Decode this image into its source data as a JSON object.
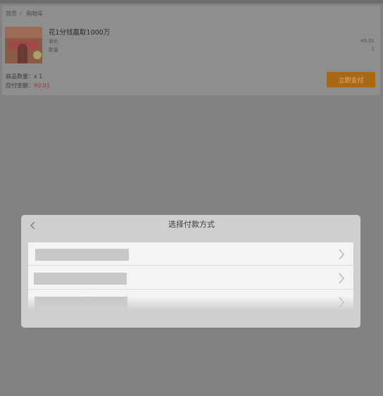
{
  "breadcrumb": {
    "items": [
      "首页",
      "购物车"
    ],
    "separator": "/"
  },
  "product": {
    "name": "花1分钱赢取1000万",
    "rows": [
      {
        "label": "单价",
        "value": "¥0.01"
      },
      {
        "label": "数量",
        "value": "1"
      }
    ]
  },
  "summary": {
    "count_label": "商品数量：",
    "count_value": "x 1",
    "total_label": "应付金额：",
    "total_value": "¥0.01"
  },
  "pay_button": {
    "label": "立即支付"
  },
  "payment_dialog": {
    "title": "选择付款方式",
    "method_rows": 3
  },
  "colors": {
    "accent": "#f39c12",
    "price": "#e74c3c",
    "overlay": "#828282"
  },
  "icons": {
    "back": "chevron-left-icon",
    "row_arrow": "chevron-right-icon"
  }
}
